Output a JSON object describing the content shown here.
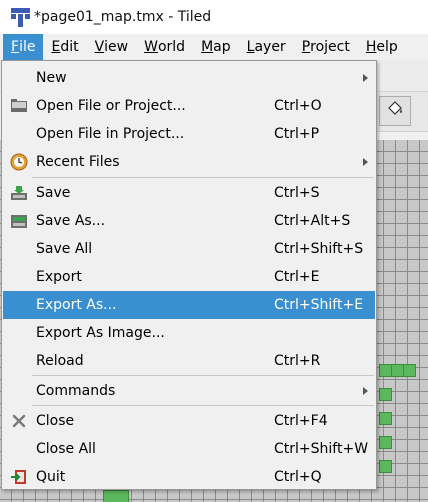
{
  "window": {
    "title": "*page01_map.tmx - Tiled"
  },
  "menubar": {
    "items": [
      {
        "label": "File",
        "mnemonic": "F",
        "active": true
      },
      {
        "label": "Edit",
        "mnemonic": "E",
        "active": false
      },
      {
        "label": "View",
        "mnemonic": "V",
        "active": false
      },
      {
        "label": "World",
        "mnemonic": "W",
        "active": false
      },
      {
        "label": "Map",
        "mnemonic": "M",
        "active": false
      },
      {
        "label": "Layer",
        "mnemonic": "L",
        "active": false
      },
      {
        "label": "Project",
        "mnemonic": "P",
        "active": false
      },
      {
        "label": "Help",
        "mnemonic": "H",
        "active": false
      }
    ]
  },
  "file_menu": {
    "items": [
      {
        "label": "New",
        "shortcut": "",
        "icon": "",
        "submenu": true
      },
      {
        "label": "Open File or Project...",
        "shortcut": "Ctrl+O",
        "icon": "open-folder-icon"
      },
      {
        "label": "Open File in Project...",
        "shortcut": "Ctrl+P",
        "icon": ""
      },
      {
        "label": "Recent Files",
        "shortcut": "",
        "icon": "recent-files-icon",
        "submenu": true
      },
      {
        "label": "Save",
        "shortcut": "Ctrl+S",
        "icon": "save-icon"
      },
      {
        "label": "Save As...",
        "shortcut": "Ctrl+Alt+S",
        "icon": "save-as-icon"
      },
      {
        "label": "Save All",
        "shortcut": "Ctrl+Shift+S",
        "icon": ""
      },
      {
        "label": "Export",
        "shortcut": "Ctrl+E",
        "icon": ""
      },
      {
        "label": "Export As...",
        "shortcut": "Ctrl+Shift+E",
        "icon": "",
        "highlighted": true
      },
      {
        "label": "Export As Image...",
        "shortcut": "",
        "icon": ""
      },
      {
        "label": "Reload",
        "shortcut": "Ctrl+R",
        "icon": ""
      },
      {
        "label": "Commands",
        "shortcut": "",
        "icon": "",
        "submenu": true
      },
      {
        "label": "Close",
        "shortcut": "Ctrl+F4",
        "icon": "close-icon"
      },
      {
        "label": "Close All",
        "shortcut": "Ctrl+Shift+W",
        "icon": ""
      },
      {
        "label": "Quit",
        "shortcut": "Ctrl+Q",
        "icon": "quit-icon"
      }
    ]
  },
  "toolbar": {
    "bucket_icon": "bucket-fill-icon"
  },
  "colors": {
    "highlight": "#3a8fd0",
    "menu_bg": "#f0f0f0",
    "tile_green": "#5cb85c",
    "grid_bg": "#c8c8c8"
  }
}
